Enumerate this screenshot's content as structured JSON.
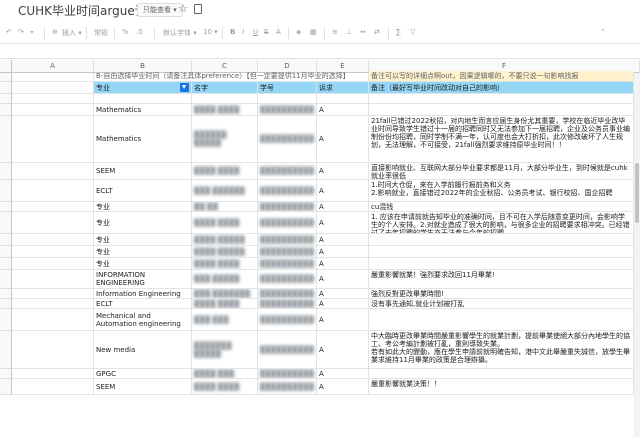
{
  "app": {
    "doc_title": "CUHK毕业时间argue诉求",
    "view_mode": "只能查看 ▾"
  },
  "toolbar": {
    "items": [
      "插入 ▾",
      "常规",
      "默认字体 ▾",
      "10 ▾",
      "B",
      "I",
      "U",
      "S",
      "A",
      "▦",
      "≡",
      "⊥",
      "↔",
      "⇄",
      "∑",
      "▽"
    ]
  },
  "columns": [
    "A",
    "B",
    "C",
    "D",
    "E",
    "F"
  ],
  "frozen_note": {
    "b": "B-自由选择毕业时间（请备注具体preference）【但一定要提供11月毕业的选择】",
    "f": "备注可以写的详细点啊out，因果逻辑哪的，不要只说一句影响找报"
  },
  "header_row": {
    "b": "专业",
    "c": "名字",
    "d": "学号",
    "e": "诉求",
    "f": "备注（最好写毕业时间改动对自己的影响）"
  },
  "rows": [
    {
      "b": "",
      "c": "",
      "d": "",
      "e": "",
      "f": ""
    },
    {
      "b": "Mathematics",
      "c": "████ ████",
      "d": "██████████",
      "e": "A",
      "f": ""
    },
    {
      "b": "Mathematics",
      "c": "██████ █████",
      "d": "██████████",
      "e": "A",
      "f": "21fall已错过2022秋招，对内地生而言应届生身份尤其重要，学校在临近毕业改毕业时间导致学生错过十一届的招聘同时又无法参加下一届招聘，企业及公务员事业编制份份均招聘，同时学制不满一年，认可度也会大打折扣，此次修改破坏了人生规划，无法理解，不可接受，21fall强烈要求维持原毕业时间！！"
    },
    {
      "b": "SEEM",
      "c": "████ ████",
      "d": "██████████",
      "e": "A",
      "f": "直接影响就业、互联网大部分毕业要求都是11月，大部分毕业生，到时候就是cuhk就业率很低"
    },
    {
      "b": "ECLT",
      "c": "███ ██████",
      "d": "██████████",
      "e": "A",
      "f": "1.时间大仓促，来在入学前履行报前务和义务\n2.影响就业，直接错过2022年的企业秋招、公务员考试、银行校招、国企招聘"
    },
    {
      "b": "专业",
      "c": "██ ██",
      "d": "██████████",
      "e": "A",
      "f": "cu混钱"
    },
    {
      "b": "专业",
      "c": "████ ████",
      "d": "██████████",
      "e": "A",
      "f": "1. 应该在申请前就告知毕业的准确时间，且不可在入学后随意变更时间，会影响学生的个人安排。2.对就业造成了很大的影响，与很多企业的招聘要求相冲突。已经错过了去年招聘的学生亦无法参与今年的招聘。"
    },
    {
      "b": "专业",
      "c": "████ █████",
      "d": "██████████",
      "e": "A",
      "f": ""
    },
    {
      "b": "专业",
      "c": "████ █████",
      "d": "██████████",
      "e": "A",
      "f": ""
    },
    {
      "b": "专业",
      "c": "████ ████",
      "d": "██████████",
      "e": "A",
      "f": ""
    },
    {
      "b": "INFORMATION ENGINEERING",
      "c": "███ █████",
      "d": "██████████",
      "e": "A",
      "f": "嚴重影響就業！強烈要求改回11月畢業!"
    },
    {
      "b": "Information Engineering",
      "c": "███ ███████",
      "d": "██████████",
      "e": "A",
      "f": "強烈反對更改畢業時間!"
    },
    {
      "b": "ECLT",
      "c": "████ ████",
      "d": "██████████",
      "e": "A",
      "f": "沒有事先通知,就业计划被打乱"
    },
    {
      "b": "Mechanical and Automation engineering",
      "c": "███ ███",
      "d": "██████████",
      "e": "A",
      "f": ""
    },
    {
      "b": "New media",
      "c": "███████ █████",
      "d": "██████████",
      "e": "A",
      "f": "中大臨時更改畢業時間嚴重影響學生的就業計劃，提前畢業使絕大部分內地學生的協工、考公考編計劃被打亂，重則導致失業。\n若有如此大的變動，應在學生申請前就明確告知，港中文此舉嚴重失誠信，放學生畢業求維持11月畢業的政策是合理辯攝。"
    },
    {
      "b": "GPGC",
      "c": "████ ███",
      "d": "██████████",
      "e": "A",
      "f": ""
    },
    {
      "b": "SEEM",
      "c": "████ ████",
      "d": "██████████",
      "e": "A",
      "f": "嚴重影響就業決策！！"
    }
  ]
}
